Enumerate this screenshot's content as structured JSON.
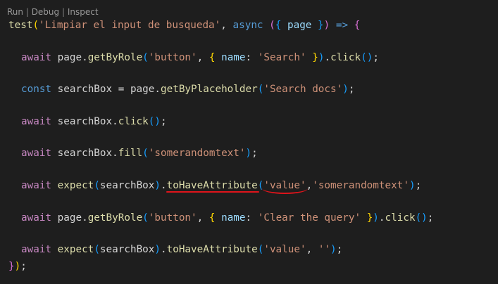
{
  "codelens": {
    "run": "Run",
    "separator": " | ",
    "debug": "Debug",
    "inspect": "Inspect"
  },
  "lines": {
    "l1": {
      "t1": "test",
      "t2": "(",
      "t3": "'Limpiar el input de busqueda'",
      "t4": ", ",
      "t5": "async",
      "t6": " ",
      "t7": "(",
      "t8": "{",
      "t9": " page ",
      "t10": "}",
      "t11": ")",
      "t12": " ",
      "t13": "=>",
      "t14": " ",
      "t15": "{"
    },
    "l2": {
      "t1": "await",
      "t2": " page.",
      "t3": "getByRole",
      "t4": "(",
      "t5": "'button'",
      "t6": ", ",
      "t7": "{",
      "t8": " name",
      "t9": ": ",
      "t10": "'Search'",
      "t11": " ",
      "t12": "}",
      "t13": ")",
      "t14": ".",
      "t15": "click",
      "t16": "()",
      "t17": ";"
    },
    "l3": {
      "t1": "const",
      "t2": " searchBox",
      "t3": " = page.",
      "t4": "getByPlaceholder",
      "t5": "(",
      "t6": "'Search docs'",
      "t7": ")",
      "t8": ";"
    },
    "l4": {
      "t1": "await",
      "t2": " searchBox.",
      "t3": "click",
      "t4": "()",
      "t5": ";"
    },
    "l5": {
      "t1": "await",
      "t2": " searchBox.",
      "t3": "fill",
      "t4": "(",
      "t5": "'somerandomtext'",
      "t6": ")",
      "t7": ";"
    },
    "l6": {
      "t1": "await",
      "t2": " ",
      "t3": "expect",
      "t4": "(",
      "t5": "searchBox",
      "t6": ")",
      "t7": ".",
      "t8": "toHaveAttribute",
      "t9": "(",
      "t10": "'value'",
      "t11": ",",
      "t12": "'somerandomtext'",
      "t13": ")",
      "t14": ";"
    },
    "l7": {
      "t1": "await",
      "t2": " page.",
      "t3": "getByRole",
      "t4": "(",
      "t5": "'button'",
      "t6": ", ",
      "t7": "{",
      "t8": " name",
      "t9": ": ",
      "t10": "'Clear the query'",
      "t11": " ",
      "t12": "}",
      "t13": ")",
      "t14": ".",
      "t15": "click",
      "t16": "()",
      "t17": ";"
    },
    "l8": {
      "t1": "await",
      "t2": " ",
      "t3": "expect",
      "t4": "(",
      "t5": "searchBox",
      "t6": ")",
      "t7": ".",
      "t8": "toHaveAttribute",
      "t9": "(",
      "t10": "'value'",
      "t11": ", ",
      "t12": "''",
      "t13": ")",
      "t14": ";"
    },
    "l9": {
      "t1": "}",
      "t2": ")",
      "t3": ";"
    }
  }
}
